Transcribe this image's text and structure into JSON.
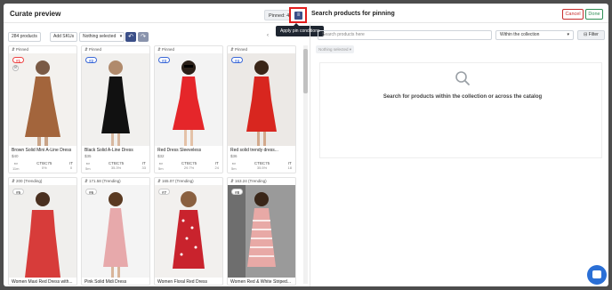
{
  "header": {
    "title": "Curate preview",
    "pinned_label": "Pinned: 4",
    "pin_conditions_tooltip": "Apply pin conditions",
    "search_title": "Search products for pinning",
    "cancel": "Cancel",
    "done": "Done"
  },
  "toolbar": {
    "products": "284 products",
    "add_skus": "Add SKUs",
    "selection": "Nothing selected"
  },
  "cards": [
    {
      "head": "⇵ Pinned",
      "badge": "#1",
      "badge_color": "#e44",
      "name": "Brown Solid Mini A-Line Dress",
      "price": "$40",
      "stats": [
        [
          "",
          "11m"
        ],
        [
          "CTBC75",
          "0%"
        ],
        [
          "IT",
          "0"
        ]
      ]
    },
    {
      "head": "⇵ Pinned",
      "badge": "#2",
      "badge_color": "#3a68d8",
      "name": "Black Solid A-Line Dress",
      "price": "$35",
      "stats": [
        [
          "",
          "5m"
        ],
        [
          "CTBC75",
          "35.3%"
        ],
        [
          "IT",
          "33"
        ]
      ]
    },
    {
      "head": "⇵ Pinned",
      "badge": "#3",
      "badge_color": "#3a68d8",
      "name": "Red Dress Sleeveless",
      "price": "$32",
      "stats": [
        [
          "",
          "5m"
        ],
        [
          "CTBC75",
          "29.7%"
        ],
        [
          "IT",
          "24"
        ]
      ]
    },
    {
      "head": "⇵ Pinned",
      "badge": "#4",
      "badge_color": "#3a68d8",
      "name": "Red solid trendy dress...",
      "price": "$36",
      "stats": [
        [
          "",
          "5m"
        ],
        [
          "CTBC75",
          "35.5%"
        ],
        [
          "IT",
          "18"
        ]
      ]
    },
    {
      "head": "⇵ 200 (Trending)",
      "badge": "#5",
      "name": "Women Maxi Red Dress with..."
    },
    {
      "head": "⇵ 171.58 (Trending)",
      "badge": "#6",
      "name": "Pink Solid Midi Dress"
    },
    {
      "head": "⇵ 165.07 (Trending)",
      "badge": "#7",
      "name": "Women Floral Red Dress"
    },
    {
      "head": "⇵ 163.24 (Trending)",
      "badge": "#8",
      "name": "Women Red & White Striped..."
    }
  ],
  "right": {
    "search_placeholder": "Search products here",
    "scope": "Within the collection",
    "filter": "Filter",
    "nothing_selected": "Nothing selected",
    "empty_text": "Search for products within the collection or across the catalog"
  },
  "colors": {
    "pin_accent": "#e21d1d",
    "primary": "#3b4f88",
    "cancel": "#c82d2d",
    "done": "#2f8f55"
  }
}
